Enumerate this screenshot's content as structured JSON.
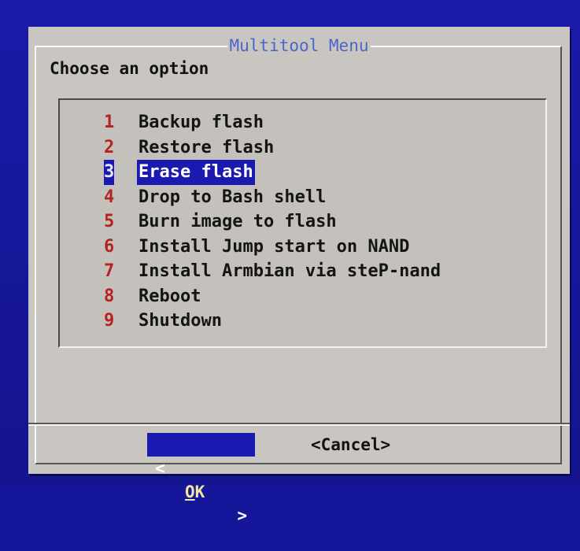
{
  "dialog": {
    "title": "Multitool Menu",
    "prompt": "Choose an option"
  },
  "menu": {
    "items": [
      {
        "tag": "1",
        "label": "Backup flash"
      },
      {
        "tag": "2",
        "label": "Restore flash"
      },
      {
        "tag": "3",
        "label": "Erase flash"
      },
      {
        "tag": "4",
        "label": "Drop to Bash shell"
      },
      {
        "tag": "5",
        "label": "Burn image to flash"
      },
      {
        "tag": "6",
        "label": "Install Jump start on NAND"
      },
      {
        "tag": "7",
        "label": "Install Armbian via steP-nand"
      },
      {
        "tag": "8",
        "label": "Reboot"
      },
      {
        "tag": "9",
        "label": "Shutdown"
      }
    ],
    "selected_index": 2
  },
  "buttons": {
    "ok_left": "<",
    "ok_label": "OK",
    "ok_right": ">",
    "cancel_label": "<Cancel>"
  },
  "colors": {
    "background": "#16169a",
    "dialog": "#c9c6c1",
    "title": "#4b66c8",
    "tag": "#b52222",
    "highlight": "#1a1ab0"
  }
}
